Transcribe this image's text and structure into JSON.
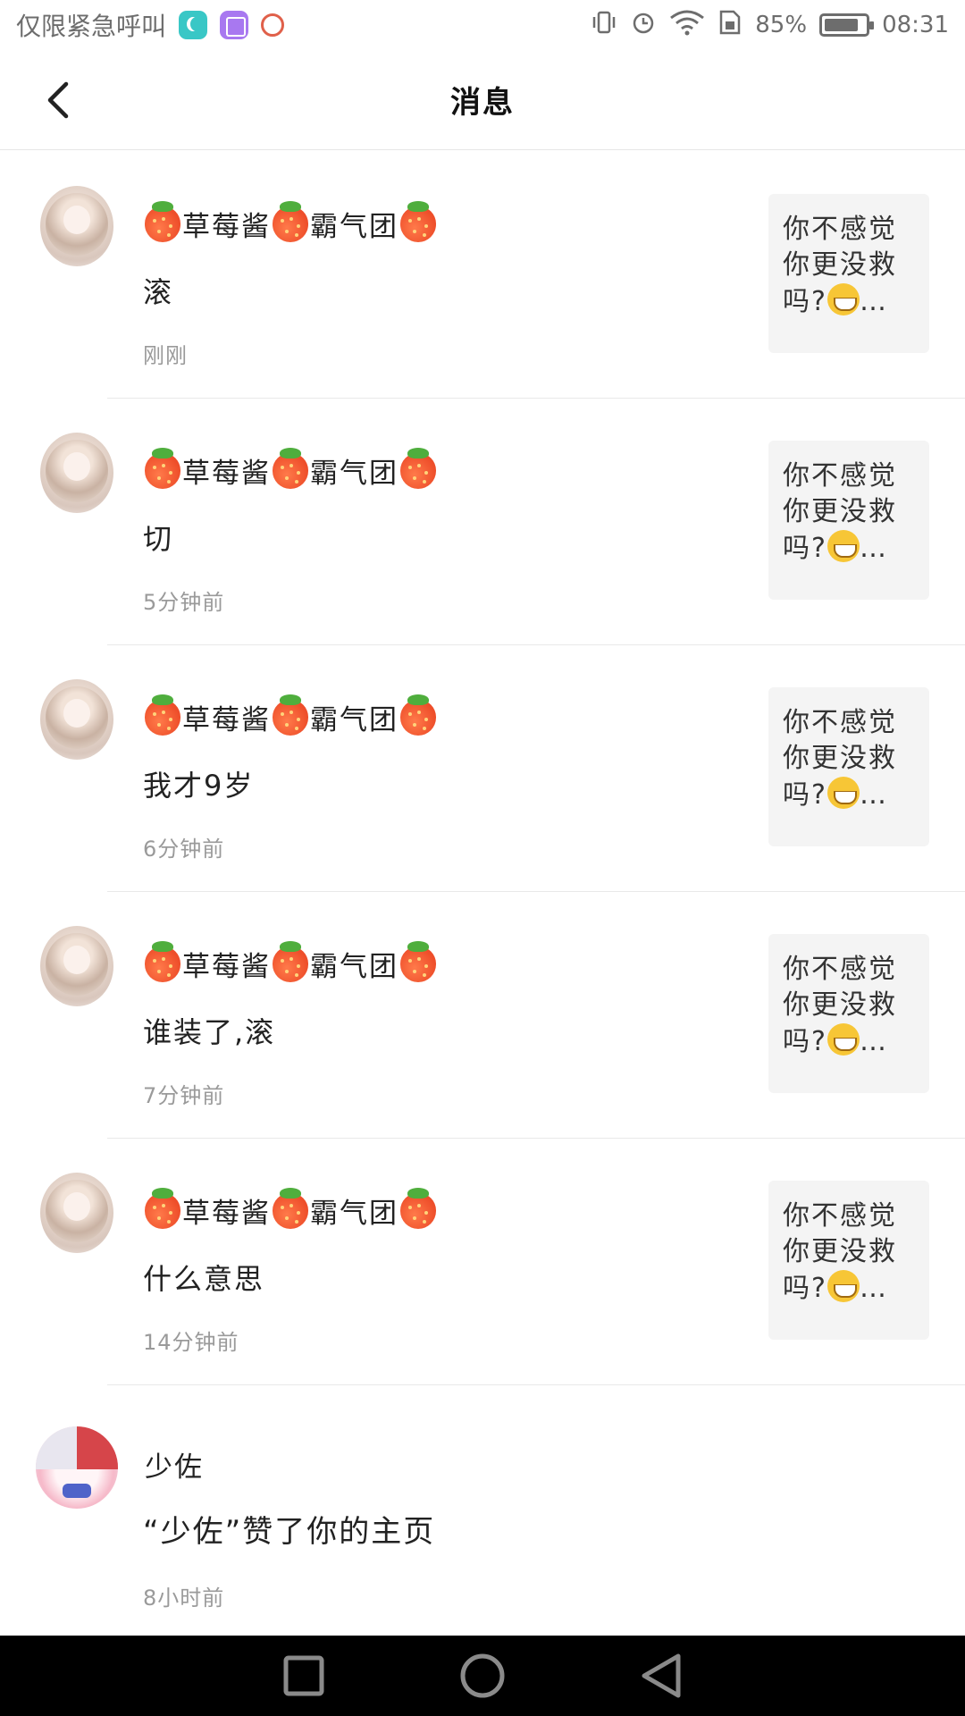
{
  "status_bar": {
    "carrier_text": "仅限紧急呼叫",
    "battery_text": "85%",
    "battery_level": 0.85,
    "time": "08:31",
    "icons": [
      "moon-app-icon",
      "gallery-app-icon",
      "spiral-app-icon",
      "vibrate-icon",
      "alarm-icon",
      "wifi-icon",
      "sim-icon",
      "battery-icon"
    ]
  },
  "header": {
    "title": "消息",
    "back_icon": "chevron-left-icon"
  },
  "messages": [
    {
      "name": "草莓酱",
      "name2": "霸气团",
      "text": "滚",
      "time": "刚刚",
      "preview_l1": "你不感觉",
      "preview_l2": "你更没救",
      "preview_l3": "吗?",
      "preview_end": "…"
    },
    {
      "name": "草莓酱",
      "name2": "霸气团",
      "text": "切",
      "time": "5分钟前",
      "preview_l1": "你不感觉",
      "preview_l2": "你更没救",
      "preview_l3": "吗?",
      "preview_end": "…"
    },
    {
      "name": "草莓酱",
      "name2": "霸气团",
      "text": "我才9岁",
      "time": "6分钟前",
      "preview_l1": "你不感觉",
      "preview_l2": "你更没救",
      "preview_l3": "吗?",
      "preview_end": "…"
    },
    {
      "name": "草莓酱",
      "name2": "霸气团",
      "text": "谁装了,滚",
      "time": "7分钟前",
      "preview_l1": "你不感觉",
      "preview_l2": "你更没救",
      "preview_l3": "吗?",
      "preview_end": "…"
    },
    {
      "name": "草莓酱",
      "name2": "霸气团",
      "text": "什么意思",
      "time": "14分钟前",
      "preview_l1": "你不感觉",
      "preview_l2": "你更没救",
      "preview_l3": "吗?",
      "preview_end": "…"
    }
  ],
  "like_notification": {
    "name": "少佐",
    "text": "“少佐”赞了你的主页",
    "time": "8小时前"
  },
  "nav_bar": {
    "buttons": [
      "recent-apps",
      "home",
      "back"
    ]
  }
}
